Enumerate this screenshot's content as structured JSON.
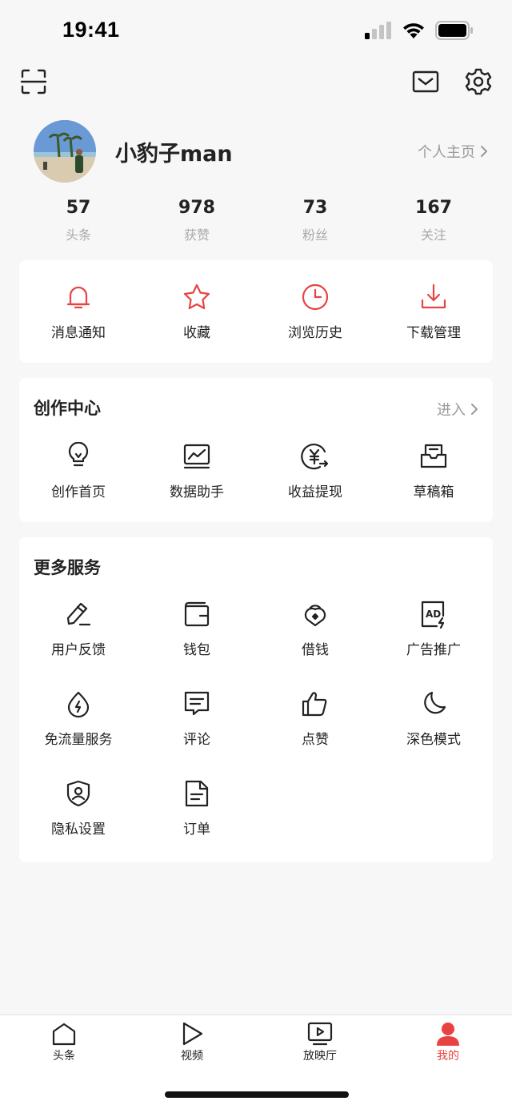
{
  "status_bar": {
    "time": "19:41"
  },
  "profile": {
    "username": "小豹子man",
    "homepage_link": "个人主页"
  },
  "stats": [
    {
      "value": "57",
      "label": "头条"
    },
    {
      "value": "978",
      "label": "获赞"
    },
    {
      "value": "73",
      "label": "粉丝"
    },
    {
      "value": "167",
      "label": "关注"
    }
  ],
  "quick_actions": [
    {
      "label": "消息通知",
      "icon": "bell-icon"
    },
    {
      "label": "收藏",
      "icon": "star-icon"
    },
    {
      "label": "浏览历史",
      "icon": "clock-icon"
    },
    {
      "label": "下载管理",
      "icon": "download-icon"
    }
  ],
  "creation_center": {
    "title": "创作中心",
    "enter_label": "进入",
    "items": [
      {
        "label": "创作首页",
        "icon": "lightbulb-icon"
      },
      {
        "label": "数据助手",
        "icon": "chart-icon"
      },
      {
        "label": "收益提现",
        "icon": "yuan-icon"
      },
      {
        "label": "草稿箱",
        "icon": "drafts-icon"
      }
    ]
  },
  "more_services": {
    "title": "更多服务",
    "items": [
      {
        "label": "用户反馈",
        "icon": "pen-icon"
      },
      {
        "label": "钱包",
        "icon": "wallet-icon"
      },
      {
        "label": "借钱",
        "icon": "loan-icon"
      },
      {
        "label": "广告推广",
        "icon": "ad-icon"
      },
      {
        "label": "免流量服务",
        "icon": "drop-icon"
      },
      {
        "label": "评论",
        "icon": "comment-icon"
      },
      {
        "label": "点赞",
        "icon": "thumbs-up-icon"
      },
      {
        "label": "深色模式",
        "icon": "moon-icon"
      },
      {
        "label": "隐私设置",
        "icon": "shield-user-icon"
      },
      {
        "label": "订单",
        "icon": "order-icon"
      }
    ]
  },
  "tab_bar": [
    {
      "label": "头条",
      "icon": "home-icon",
      "active": false
    },
    {
      "label": "视频",
      "icon": "play-icon",
      "active": false
    },
    {
      "label": "放映厅",
      "icon": "screen-icon",
      "active": false
    },
    {
      "label": "我的",
      "icon": "user-icon",
      "active": true
    }
  ],
  "colors": {
    "accent": "#e94242",
    "text": "#222222",
    "muted": "#9a9a9a",
    "background": "#f7f7f7"
  }
}
